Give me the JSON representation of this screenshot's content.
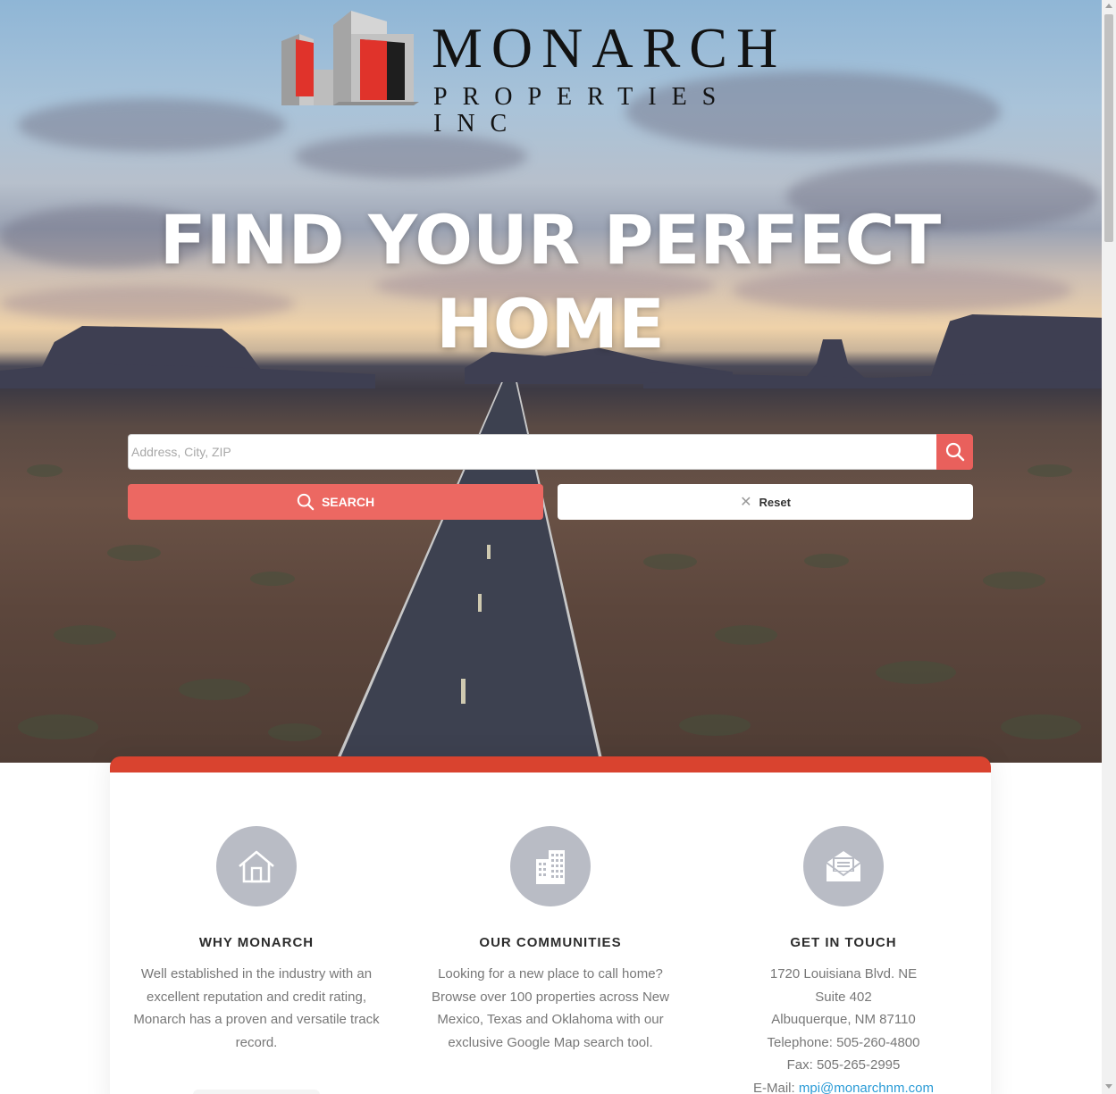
{
  "brand": {
    "name": "MONARCH",
    "subtitle": "PROPERTIES INC",
    "accent_red": "#d9432f",
    "logo_gray": "#b9b9b9"
  },
  "hero": {
    "headline_line1": "FIND YOUR PERFECT",
    "headline_line2": "HOME"
  },
  "search": {
    "placeholder": "Address, City, ZIP",
    "value": "",
    "search_label": "SEARCH",
    "reset_label": "Reset",
    "button_color": "#ec6862"
  },
  "features": [
    {
      "icon": "home-icon",
      "title": "WHY MONARCH",
      "text": "Well established in the industry with an excellent reputation and credit rating, Monarch has a proven and versatile track record."
    },
    {
      "icon": "buildings-icon",
      "title": "OUR COMMUNITIES",
      "text": "Looking for a new place to call home? Browse over 100 properties across New Mexico, Texas and Oklahoma with our exclusive Google Map search tool."
    },
    {
      "icon": "mail-icon",
      "title": "GET IN TOUCH",
      "address1": "1720 Louisiana Blvd. NE",
      "address2": "Suite 402",
      "address3": "Albuquerque, NM 87110",
      "telephone": "Telephone: 505-260-4800",
      "fax": "Fax: 505-265-2995",
      "email_label": "E-Mail:",
      "email": "mpi@monarchnm.com"
    }
  ]
}
